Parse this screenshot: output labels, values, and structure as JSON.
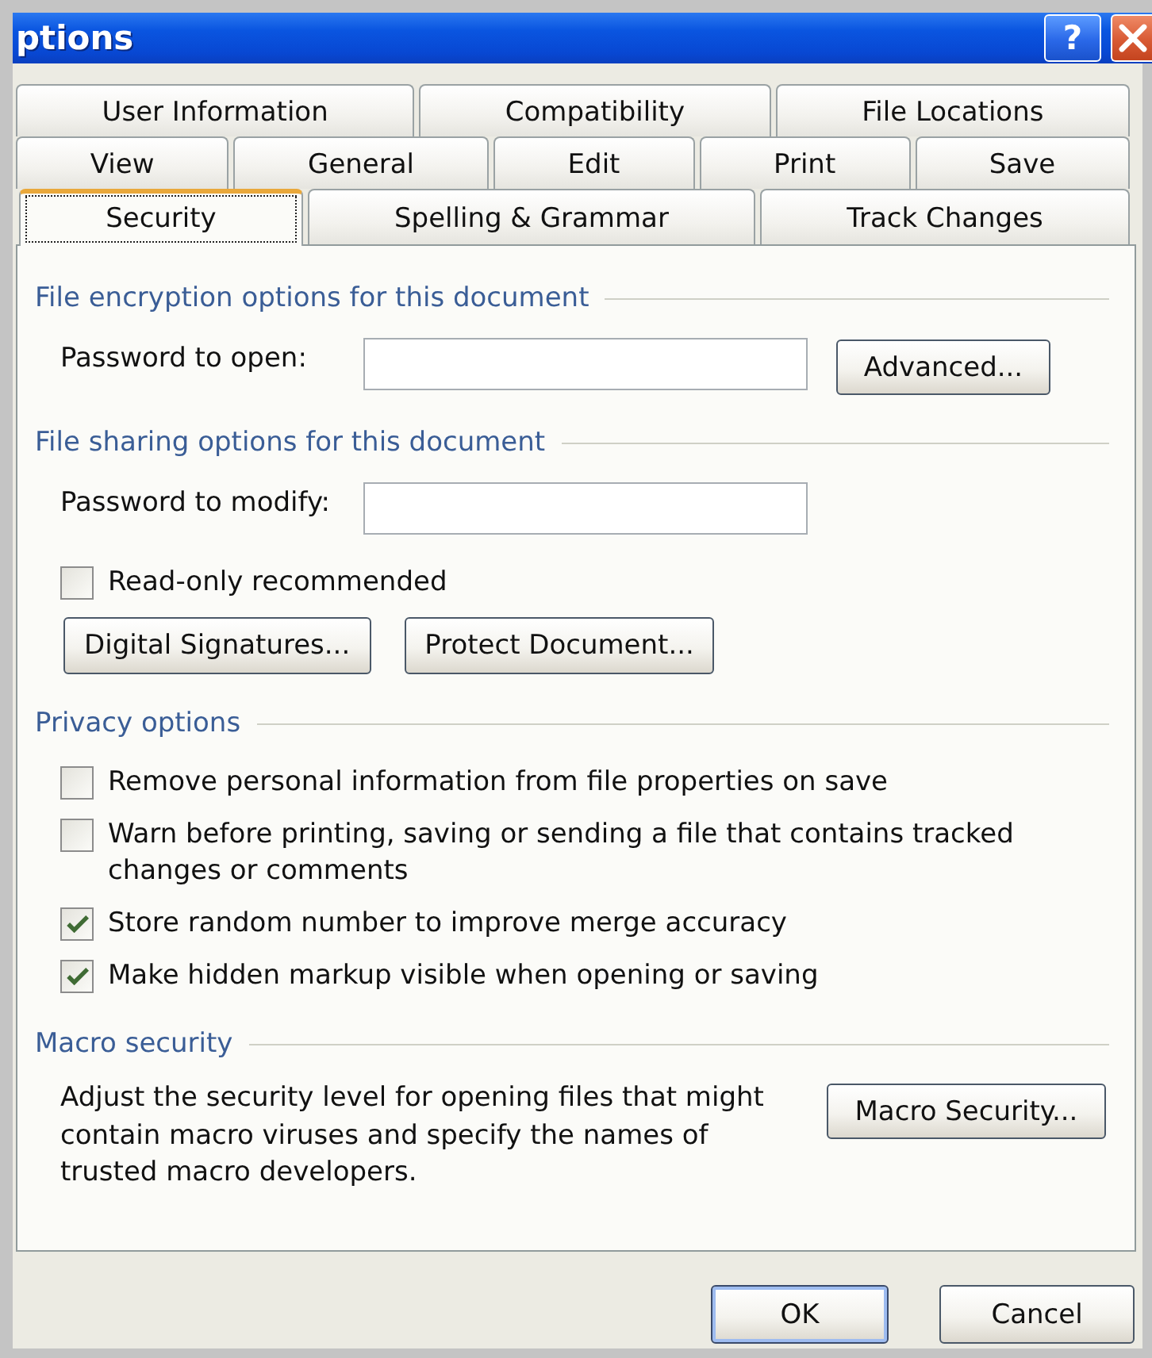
{
  "window": {
    "title": "ptions",
    "help_label": "?"
  },
  "tab_rows": [
    [
      {
        "label": "User Information",
        "selected": false
      },
      {
        "label": "Compatibility",
        "selected": false
      },
      {
        "label": "File Locations",
        "selected": false
      }
    ],
    [
      {
        "label": "View",
        "selected": false
      },
      {
        "label": "General",
        "selected": false
      },
      {
        "label": "Edit",
        "selected": false
      },
      {
        "label": "Print",
        "selected": false
      },
      {
        "label": "Save",
        "selected": false
      }
    ],
    [
      {
        "label": "Security",
        "selected": true
      },
      {
        "label": "Spelling & Grammar",
        "selected": false
      },
      {
        "label": "Track Changes",
        "selected": false
      }
    ]
  ],
  "sections": [
    {
      "heading": "File encryption options for this document",
      "items": [
        {
          "kind": "field",
          "label": "Password to open:",
          "button": {
            "label": "Advanced..."
          }
        }
      ]
    },
    {
      "heading": "File sharing options for this document",
      "items": [
        {
          "kind": "field",
          "label": "Password to modify:"
        },
        {
          "kind": "checkbox",
          "label": "Read-only recommended",
          "checked": false
        },
        {
          "kind": "buttons",
          "buttons": [
            {
              "label": "Digital Signatures..."
            },
            {
              "label": "Protect Document..."
            }
          ]
        }
      ]
    },
    {
      "heading": "Privacy options",
      "items": [
        {
          "kind": "checkbox",
          "label": "Remove personal information from file properties on save",
          "checked": false
        },
        {
          "kind": "checkbox",
          "label": "Warn before printing, saving or sending a file that contains tracked changes or comments",
          "checked": false
        },
        {
          "kind": "checkbox",
          "label": "Store random number to improve merge accuracy",
          "checked": true
        },
        {
          "kind": "checkbox",
          "label": "Make hidden markup visible when opening or saving",
          "checked": true
        }
      ]
    },
    {
      "heading": "Macro security",
      "items": [
        {
          "kind": "note",
          "text": "Adjust the security level for opening files that might contain macro viruses and specify the names of trusted macro developers.",
          "button": {
            "label": "Macro Security..."
          }
        }
      ]
    }
  ],
  "buttons": [
    {
      "label": "OK",
      "default": true
    },
    {
      "label": "Cancel",
      "default": false
    }
  ]
}
